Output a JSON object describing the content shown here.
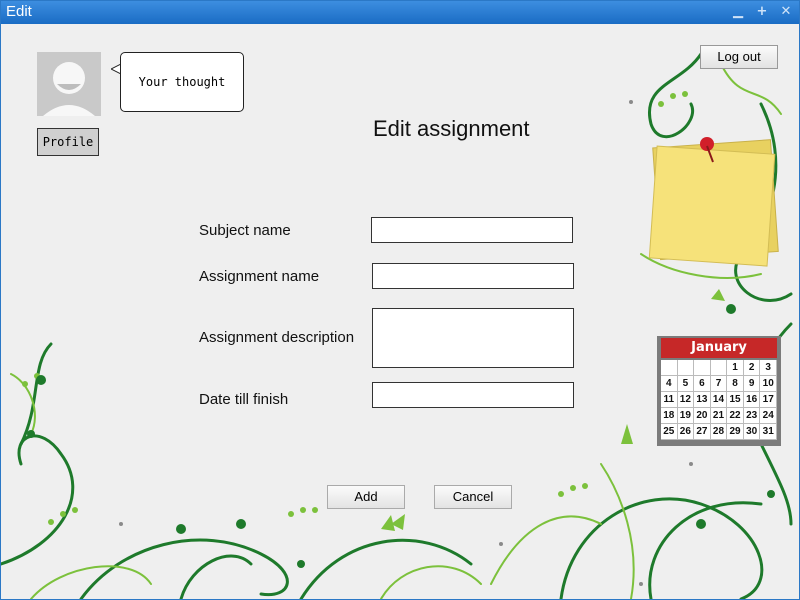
{
  "window": {
    "title": "Edit"
  },
  "header": {
    "speech_bubble": "Your thought",
    "profile_button": "Profile",
    "logout_button": "Log out"
  },
  "form": {
    "title": "Edit assignment",
    "fields": [
      {
        "label": "Subject name",
        "value": ""
      },
      {
        "label": "Assignment name",
        "value": ""
      },
      {
        "label": "Assignment description",
        "value": ""
      },
      {
        "label": "Date till finish",
        "value": ""
      }
    ],
    "add_button": "Add",
    "cancel_button": "Cancel"
  },
  "calendar": {
    "month": "January",
    "days": [
      "",
      "",
      "",
      "",
      "1",
      "2",
      "3",
      "4",
      "5",
      "6",
      "7",
      "8",
      "9",
      "10",
      "11",
      "12",
      "13",
      "14",
      "15",
      "16",
      "17",
      "18",
      "19",
      "20",
      "21",
      "22",
      "23",
      "24",
      "25",
      "26",
      "27",
      "28",
      "29",
      "30",
      "31"
    ]
  },
  "icons": {
    "avatar": "user-avatar-icon",
    "sticky_note": "sticky-note-icon",
    "calendar": "calendar-icon",
    "minimize": "minimize-icon",
    "maximize": "maximize-icon",
    "close": "close-icon"
  },
  "colors": {
    "titlebar": "#1f73c8",
    "vine_dark": "#1e7a2b",
    "vine_light": "#7cc13c",
    "calendar_header": "#c62828",
    "note_yellow": "#f6e27a"
  }
}
